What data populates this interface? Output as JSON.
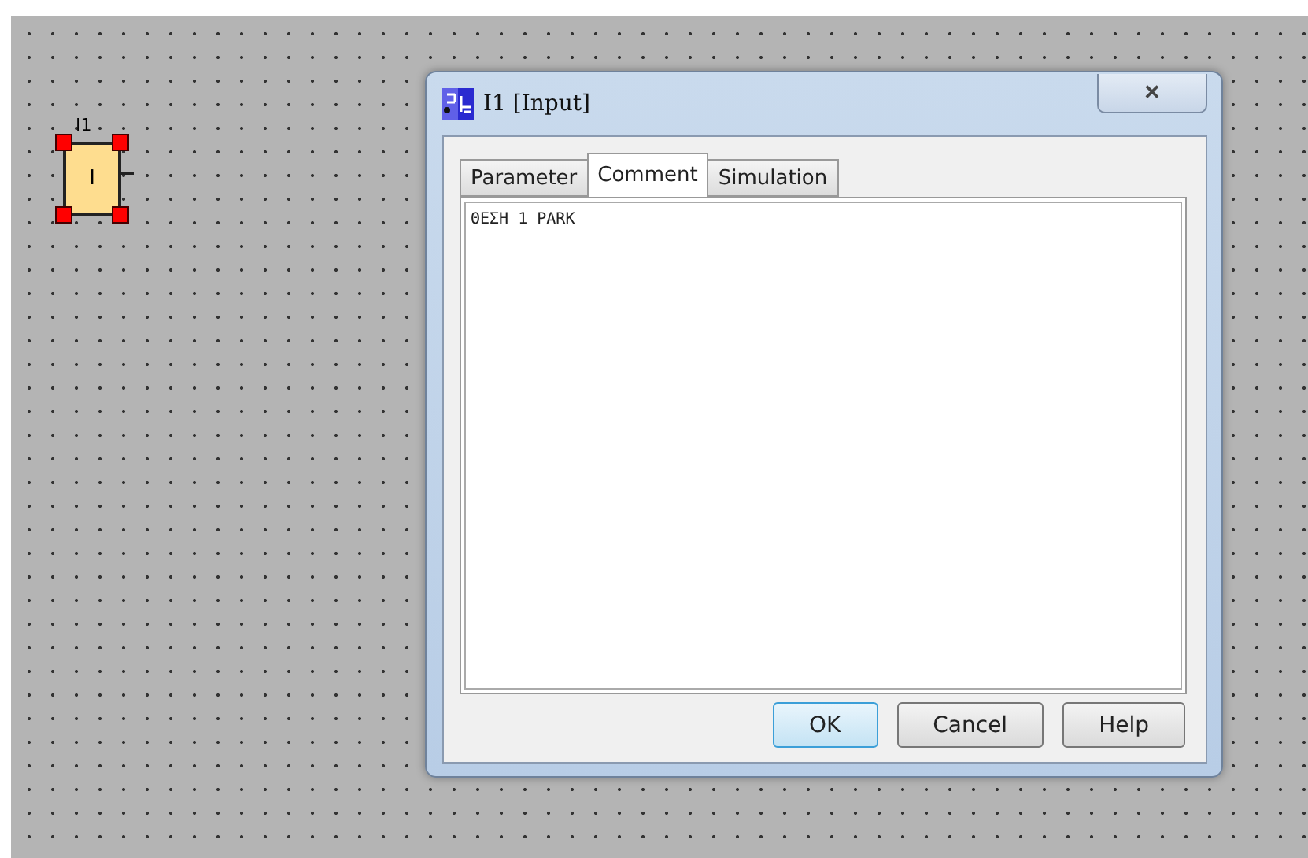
{
  "block": {
    "name": "I1",
    "symbol": "I",
    "selected": true
  },
  "dialog": {
    "title": "I1 [Input]",
    "close": "✕",
    "tabs": [
      {
        "label": "Parameter",
        "selected": false
      },
      {
        "label": "Comment",
        "selected": true
      },
      {
        "label": "Simulation",
        "selected": false
      }
    ],
    "comment": "ΘΕΣΗ 1 PARK",
    "buttons": [
      {
        "label": "OK",
        "default": true
      },
      {
        "label": "Cancel",
        "default": false
      },
      {
        "label": "Help",
        "default": false
      }
    ]
  }
}
